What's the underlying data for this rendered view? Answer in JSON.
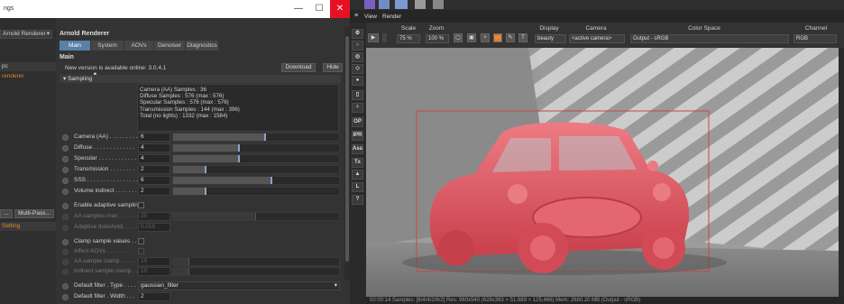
{
  "dialog": {
    "title": "ngs",
    "controls": [
      "—",
      "☐",
      "✕"
    ],
    "left_items": [
      "Arnold Renderer",
      "pc",
      "renderer"
    ],
    "left_buttons": [
      "...",
      "Multi-Pass..."
    ],
    "left_setting": "Setting",
    "panel_title": "Arnold Renderer",
    "tabs": [
      "Main",
      "System",
      "AOVs",
      "Denoiser",
      "Diagnostics"
    ],
    "section_main": "Main",
    "update_message": "New version is available online: 3.0.4.1",
    "download_label": "Download",
    "hide_label": "Hide",
    "sampling_header": "Sampling",
    "info_lines": [
      "Camera (AA) Samples : 36",
      "Diffuse Samples : 576 (max : 576)",
      "Specular Samples : 576 (max : 576)",
      "Transmission Samples : 144 (max : 396)",
      "Total (no lights) : 1332 (max : 1584)"
    ],
    "samples": [
      {
        "label": "Camera (AA) . . . . . . . . .",
        "value": "6",
        "level": 0.56,
        "orange": false
      },
      {
        "label": "Diffuse . . . . . . . . . . . . .",
        "value": "4",
        "level": 0.4,
        "orange": false
      },
      {
        "label": "Specular . . . . . . . . . . . .",
        "value": "4",
        "level": 0.4,
        "orange": false
      },
      {
        "label": "Transmission . . . . . . . .",
        "value": "2",
        "level": 0.2,
        "orange": true
      },
      {
        "label": "SSS . . . . . . . . . . . . . . . .",
        "value": "6",
        "level": 0.6,
        "orange": false
      },
      {
        "label": "Volume indirect . . . . . . .",
        "value": "2",
        "level": 0.2,
        "orange": false
      }
    ],
    "adaptive_label": "Enable adaptive sampling",
    "aa_max_label": "AA samples max. . . . . . . .",
    "aa_max_value": "20",
    "adaptive_threshold_label": "Adaptive threshold. . . . .",
    "adaptive_threshold_value": "0.015",
    "clamp_label": "Clamp sample values . . .",
    "affect_aovs_label": "Affect AOVs . . . . . . . .",
    "aa_clamp_label": "AA sample clamp . . . . . .",
    "aa_clamp_value": "10",
    "indirect_clamp_label": "Indirect sample clamp . . .",
    "indirect_clamp_value": "10",
    "filter_type_label": "Default filter . Type . . . .",
    "filter_type_value": "gaussian_filter",
    "filter_width_label": "Default filter . Width . . .",
    "filter_width_value": "2"
  },
  "app": {
    "menu": [
      "View",
      "Render"
    ],
    "toolbar": {
      "scale_label": "Scale",
      "scale_value": "75 %",
      "zoom_label": "Zoom",
      "zoom_value": "100 %",
      "display_label": "Display",
      "display_value": "beauty",
      "camera_label": "Camera",
      "camera_value": "<active camera>",
      "colorspace_label": "Color Space",
      "colorspace_value": "Output - sRGB",
      "channel_label": "Channel",
      "channel_value": "RGB"
    },
    "side_icons": [
      "OP",
      "IPR",
      "Ass",
      "Tx",
      "L",
      "?"
    ],
    "status": "00:00:14  Samples: [6/4/4/2/6/2]  Res: 960x540 (628x363 > 51,689 > 125,466)  Mem: 2660.20 MB  (Output - sRGB)"
  },
  "colors": {
    "car": "#e05560",
    "accent": "#5a7fa8",
    "orange": "#e0852a"
  }
}
